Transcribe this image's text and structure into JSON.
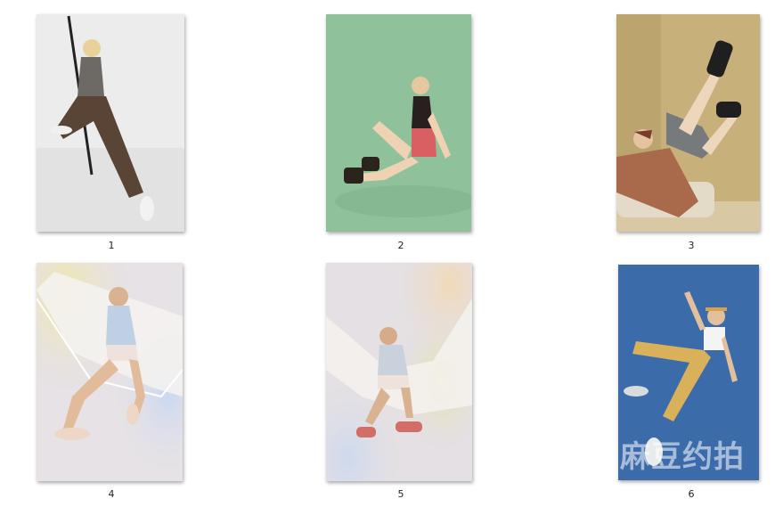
{
  "gallery": {
    "items": [
      {
        "label": "1"
      },
      {
        "label": "2"
      },
      {
        "label": "3"
      },
      {
        "label": "4"
      },
      {
        "label": "5"
      },
      {
        "label": "6"
      }
    ],
    "watermark": "麻豆约拍"
  },
  "colors": {
    "photo1_bg": "#ececec",
    "photo2_bg": "#8fc29a",
    "photo3_bg": "#c8b07a",
    "photo4_bg": "#e6e2e6",
    "photo5_bg": "#e4e0e4",
    "photo6_bg": "#3f6fae"
  }
}
